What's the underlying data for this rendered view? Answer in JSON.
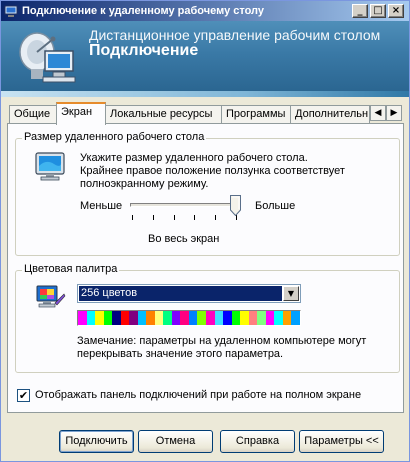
{
  "window": {
    "title": "Подключение к удаленному рабочему столу",
    "icon": "remote-desktop-icon",
    "controls": {
      "minimize": "_",
      "maximize": "□",
      "close": "×"
    }
  },
  "banner": {
    "subtitle": "Дистанционное управление рабочим столом",
    "title": "Подключение",
    "icon": "monitor-satellite-icon"
  },
  "tabs": [
    {
      "label": "Общие",
      "active": false
    },
    {
      "label": "Экран",
      "active": true
    },
    {
      "label": "Локальные ресурсы",
      "active": false
    },
    {
      "label": "Программы",
      "active": false
    },
    {
      "label": "Дополнительн",
      "active": false
    }
  ],
  "tab_scroll": {
    "left": "◀",
    "right": "▶"
  },
  "display_size": {
    "group_label": "Размер удаленного рабочего стола",
    "description": [
      "Укажите размер удаленного рабочего стола.",
      "Крайнее правое положение ползунка соответствует",
      "полноэкранному режиму."
    ],
    "min_label": "Меньше",
    "max_label": "Больше",
    "value_label": "Во весь экран",
    "slider_position": 1.0,
    "tick_count": 6
  },
  "colors": {
    "group_label": "Цветовая палитра",
    "selected": "256 цветов",
    "note": [
      "Замечание: параметры на удаленном компьютере могут",
      "перекрывать значение этого параметра."
    ],
    "palette_swatches": [
      "#ff00ff",
      "#00ffff",
      "#ffff00",
      "#00ff00",
      "#000080",
      "#ff0000",
      "#800080",
      "#00c0ff",
      "#ff8000",
      "#ffff80",
      "#00ff80",
      "#8000ff",
      "#ff0080",
      "#0080ff",
      "#80ff00",
      "#ff00c0",
      "#40e0ff",
      "#0000ff",
      "#00ff00",
      "#ffff00",
      "#ff8080",
      "#80ff80",
      "#ff00ff",
      "#00ffff",
      "#ffa000",
      "#00a0ff"
    ]
  },
  "connection_bar": {
    "label": "Отображать панель подключений при работе на полном экране",
    "checked": true,
    "check_mark": "✔"
  },
  "buttons": {
    "connect": "Подключить",
    "cancel": "Отмена",
    "help": "Справка",
    "options": "Параметры <<"
  }
}
